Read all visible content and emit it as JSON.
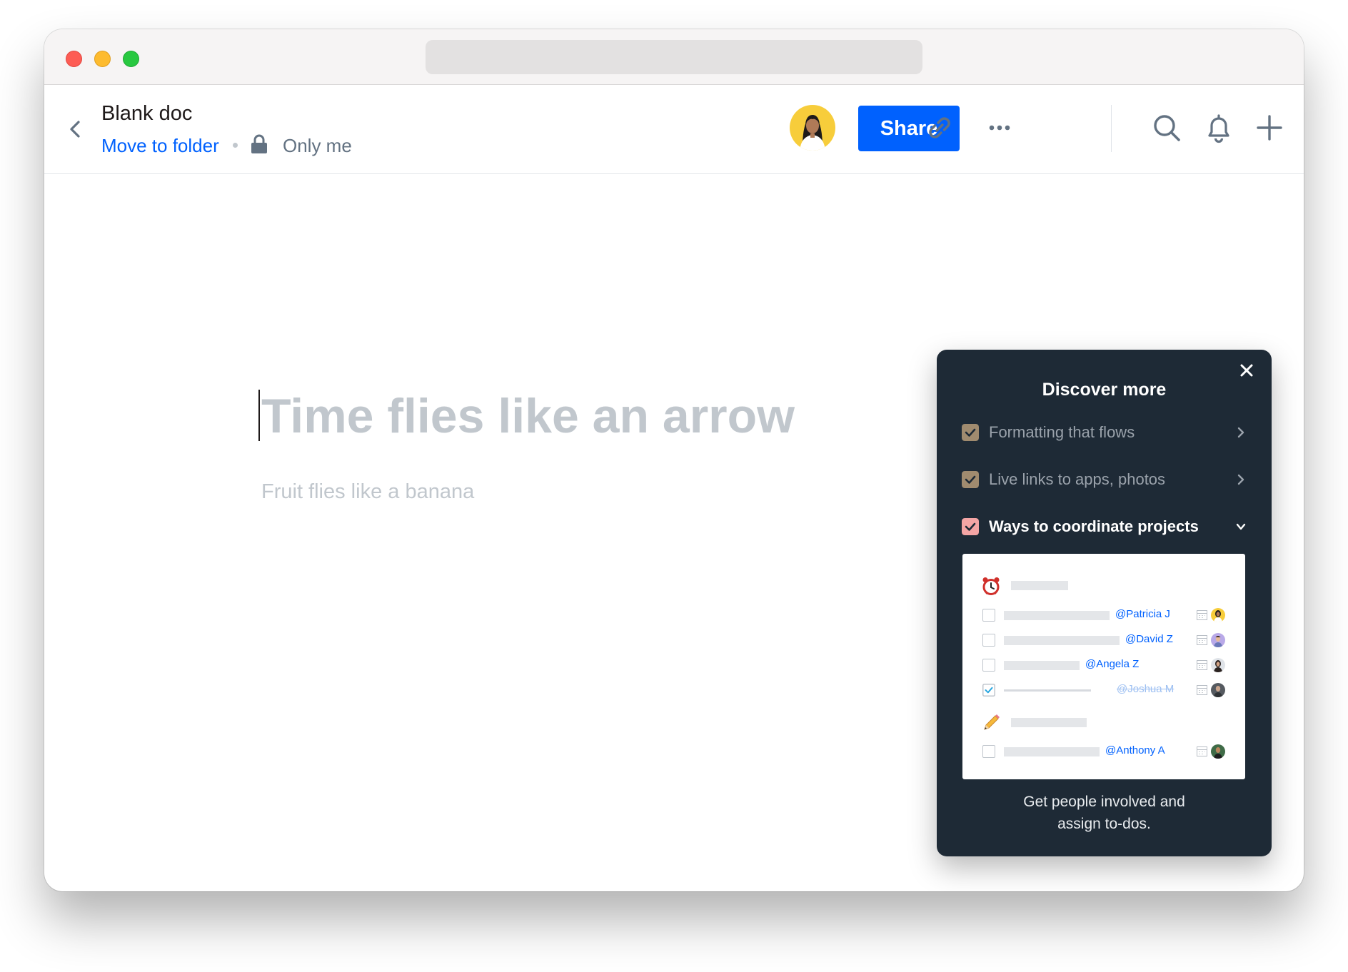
{
  "document": {
    "title": "Blank doc",
    "move_to_folder": "Move to folder",
    "visibility": "Only me",
    "heading_placeholder": "Time flies like an arrow",
    "body_placeholder": "Fruit flies like a banana"
  },
  "header": {
    "share_label": "Share",
    "icons": [
      "back-icon",
      "lock-icon",
      "link-icon",
      "more-icon",
      "search-icon",
      "bell-icon",
      "plus-icon"
    ]
  },
  "discover": {
    "title": "Discover more",
    "items": [
      {
        "label": "Formatting that flows",
        "checked": true,
        "expanded": false
      },
      {
        "label": "Live links to apps, photos",
        "checked": true,
        "expanded": false
      },
      {
        "label": "Ways to coordinate projects",
        "checked": true,
        "expanded": true
      }
    ],
    "preview": {
      "section_icons": [
        "alarm-clock-icon",
        "pencil-icon"
      ],
      "tasks": [
        {
          "mention": "@Patricia J",
          "done": false
        },
        {
          "mention": "@David Z",
          "done": false
        },
        {
          "mention": "@Angela Z",
          "done": false
        },
        {
          "mention": "@Joshua M",
          "done": true
        },
        {
          "mention": "@Anthony A",
          "done": false
        }
      ]
    },
    "caption_line1": "Get people involved and",
    "caption_line2": "assign to-dos."
  },
  "colors": {
    "accent": "#0061fe",
    "panel_bg": "#1e2a36",
    "check_done_tan": "#a08b6f",
    "check_active_pink": "#f4a5a5",
    "avatar_bg": "#f7cd3b"
  }
}
